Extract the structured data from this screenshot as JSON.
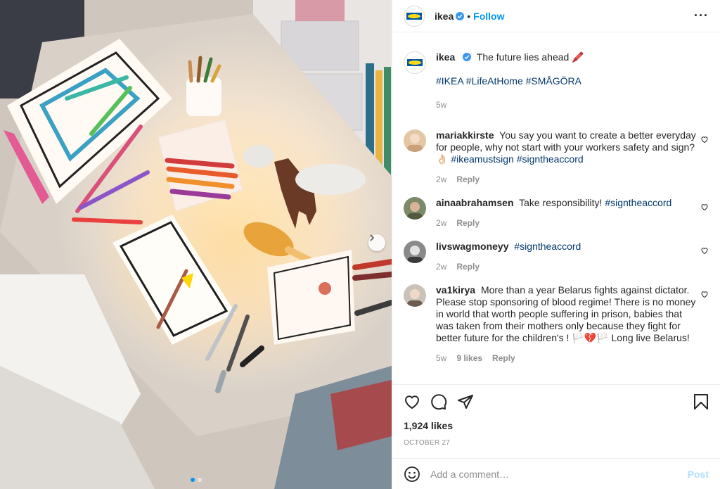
{
  "colors": {
    "accent": "#0095f6",
    "hashtag": "#00376b",
    "muted": "#8e8e8e",
    "verified": "#3897f0"
  },
  "header": {
    "username": "ikea",
    "follow_label": "Follow",
    "more_icon": "more-horizontal-icon"
  },
  "caption": {
    "username": "ikea",
    "text": "The future lies ahead 🖍️",
    "hashtags": "#IKEA #LifeAtHome #SMÅGÖRA",
    "time": "5w"
  },
  "comments": [
    {
      "username": "mariakkirste",
      "text": "You say you want to create a better everyday for people, why not start with your workers safety and sign? 👌🏻",
      "hashtags": "#ikeamustsign #signtheaccord",
      "time": "2w",
      "likes": "",
      "reply_label": "Reply"
    },
    {
      "username": "ainaabrahamsen",
      "text": "Take responsibility!",
      "hashtags": "#signtheaccord",
      "time": "2w",
      "likes": "",
      "reply_label": "Reply"
    },
    {
      "username": "livswagmoneyy",
      "text": "",
      "hashtags": "#signtheaccord",
      "time": "2w",
      "likes": "",
      "reply_label": "Reply"
    },
    {
      "username": "va1kirya",
      "text": "More than a year Belarus fights against dictator. Please stop sponsoring of blood regime! There is no money in world that worth people suffering in prison, babies that was taken from their mothers only because they fight for better future for the children's ! 🏳️💔🏳️ Long live Belarus!",
      "hashtags": "",
      "time": "5w",
      "likes": "9 likes",
      "reply_label": "Reply"
    }
  ],
  "actions": {
    "likes_count": "1,924 likes",
    "date": "OCTOBER 27"
  },
  "add_comment": {
    "placeholder": "Add a comment…",
    "post_label": "Post"
  },
  "carousel": {
    "slide_count": 2,
    "active_index": 0
  }
}
